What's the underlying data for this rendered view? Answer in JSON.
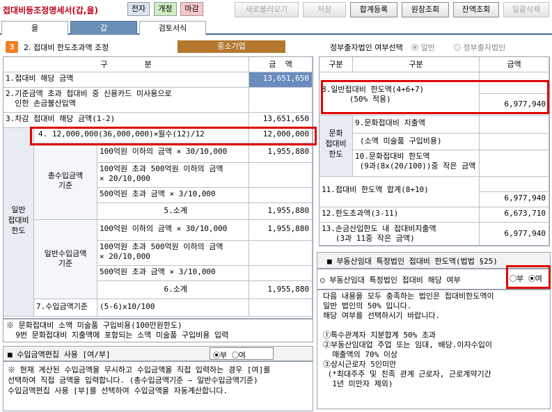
{
  "toolbar": {
    "title": "접대비등조정명세서(갑,을)",
    "tags": [
      "전자",
      "개정",
      "마감"
    ],
    "buttons": [
      "새로불러오기",
      "저장",
      "합계등록",
      "원장조회",
      "잔액조회",
      "일괄삭제"
    ]
  },
  "tabs": [
    "을",
    "갑",
    "검토서식"
  ],
  "section": {
    "number": "3",
    "title": "2. 접대비 한도초과액 조정",
    "company_type": "중소기업",
    "gov_label": "정부출자법인 여부선택",
    "opt_general": "일반",
    "opt_gov": "정부출자법인"
  },
  "colors": {
    "accent": "#6b90b8",
    "highlight": "#e00000",
    "selected_cell": "#6a8cbe",
    "brown_button": "#b5782e"
  },
  "left_table": {
    "head_label": "구        분",
    "head_amount": "금  액",
    "row1_label": "1.접대비 해당 금액",
    "row1_value": "13,651,650",
    "row2_label": "2.기준금액 초과 접대비 중 신용카드 미사용으로\n  인한 손금불산입액",
    "row3_label": "3.차감 접대비 해당 금액(1-2)",
    "row3_value": "13,651,650",
    "row4_label": "4. 12,000,000(36,000,000)×월수(12)/12",
    "row4_value": "12,000,000",
    "group_general": "일반\n접대비\n한도",
    "total_label": "총수입금액\n기준",
    "general_label": "일반수입금액\n기준",
    "t1": "100억원 이하의 금액 × 30/10,000",
    "t1_value": "1,955,880",
    "t2": "100억원 초과 500억원 이하의 금액\n× 20/10,000",
    "t3": "500억원 초과 금액 × 3/10,000",
    "t_sub": "5.소계",
    "t_sub_value": "1,955,880",
    "g1": "100억원 이하의 금액 × 30/10,000",
    "g1_value": "1,955,880",
    "g2": "100억원 초과 500억원 이하의 금액\n× 20/10,000",
    "g3": "500억원 초과 금액 × 3/10,000",
    "g_sub": "6.소계",
    "g_sub_value": "1,955,880",
    "row7_label": "7.수입금액기준",
    "row7_formula": "(5-6)x10/100"
  },
  "footnote": "※ 문화접대비 소액 미술품 구입비용(100만원한도)\n  9번 문화접대비 지출액에 포함되는 소액 미술품 구입비용 입력",
  "revenue_edit": {
    "title": "■  수입금액편집 사용 [여/부]",
    "opt_no": "부",
    "opt_yes": "여",
    "note": "※ 현재 계산된 수입금액을 무시하고 수입금액을 직접 입력하는 경우 [여]를\n선택하여 직접 금액을 입력합니다. (총수입금액기준 ~ 일반수입금액기준)\n수입금액편집 사용 [부]를 선택하여 수입금액을 자동계산합니다."
  },
  "right_table": {
    "head_gubun": "구분",
    "head_gubun2": "구분",
    "head_amount": "금액",
    "row8_label": "8.일반접대비 한도액(4+6+7)\n      (50% 적용)",
    "row8_value": "6,977,940",
    "culture_label": "문화\n접대비\n한도",
    "row9_label": "9.문화접대비 지출액",
    "row9b_label": "(소액 미술품 구입비용)",
    "row10_label": "10.문화접대비 한도액\n (9과(8x(20/100))중 작은 금액",
    "row11_label": "11.접대비 한도액 합계(8+10)",
    "row11_value": "6,977,940",
    "row12_label": "12.한도초과액(3-11)",
    "row12_value": "6,673,710",
    "row13_label": "13.손금산입한도 내 접대비지출액\n   (3과 11중 작은 금액)",
    "row13_value": "6,977,940"
  },
  "realty": {
    "title": "■  부동산임대 특정법인 접대비 한도액(법법 §25)",
    "question": "○  부동산임대 특정법인 접대비 해당 여부",
    "opt_no": "부",
    "opt_yes": "여",
    "text": "다음 내용을 모두 충족하는 법인은 접대비한도액이\n일반 법인의 50% 입니다.\n해당 여부를 선택하시기 바랍니다.\n\n①특수관계자 지분합계 50% 초과\n②부동산임대업 주업 또는 임대, 배당.이자수입이\n  매출액의 70% 이상\n③상시근로자 5인미만\n (*최대주주 및 친족 관계 근로자, 근로계약기간\n  1년 미만자 제외)"
  }
}
